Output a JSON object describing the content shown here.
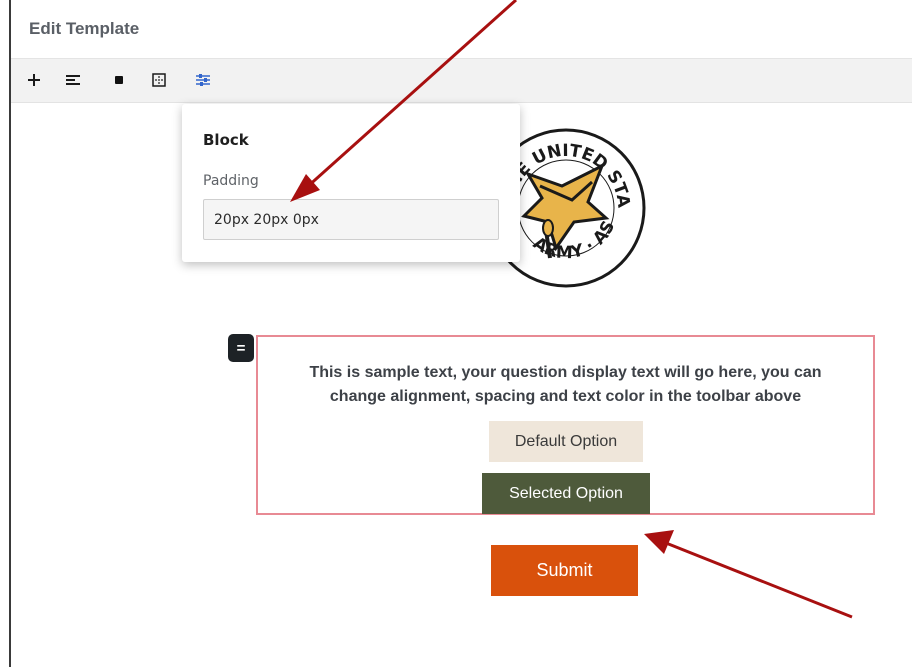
{
  "window": {
    "title": "Edit Template"
  },
  "toolbar": {
    "buttons": [
      {
        "name": "add",
        "icon": "plus-icon",
        "glyph": "+"
      },
      {
        "name": "align",
        "icon": "align-left-icon"
      },
      {
        "name": "color",
        "icon": "square-icon"
      },
      {
        "name": "spacing",
        "icon": "grid-icon"
      },
      {
        "name": "settings",
        "icon": "sliders-icon",
        "active": true
      }
    ],
    "active_color": "#3366cc"
  },
  "popover": {
    "title": "Block",
    "padding_label": "Padding",
    "padding_value": "20px 20px 0px"
  },
  "logo": {
    "icon": "army-seal-icon",
    "text_top": "THE UNITED STATES",
    "text_bottom": "ARMY · ASS"
  },
  "question": {
    "handle_glyph": "=",
    "text_line1": "This is sample text, your question display text will go here, you can",
    "text_line2": "change alignment, spacing and text color in the toolbar above",
    "default_option": "Default Option",
    "selected_option": "Selected Option",
    "border_color": "#e88a94"
  },
  "submit": {
    "label": "Submit",
    "color": "#d9510c"
  },
  "annotations": {
    "arrow_color": "#a81010"
  }
}
